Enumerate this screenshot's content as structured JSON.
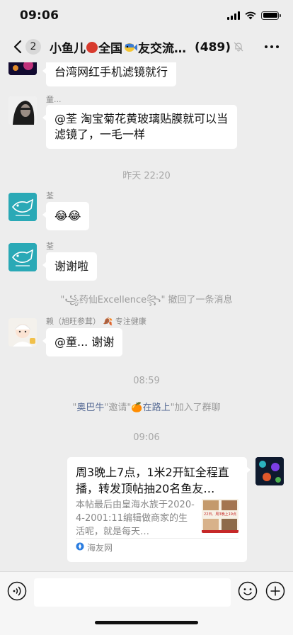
{
  "status_bar": {
    "time": "09:06"
  },
  "nav": {
    "unread_count": "2",
    "title_part1": "小鱼儿",
    "title_part2": "全国",
    "title_part3": "友交流…",
    "member_count": "(489)"
  },
  "messages": [
    {
      "id": "m1",
      "sender": "",
      "text": "台湾网红手机滤镜就行"
    },
    {
      "id": "m2",
      "sender": "童...",
      "text": "@荃 淘宝菊花黄玻璃贴膜就可以当滤镜了，一毛一样"
    },
    {
      "id": "m3",
      "sender": "荃",
      "text": "😂😂"
    },
    {
      "id": "m4",
      "sender": "荃",
      "text": "谢谢啦"
    },
    {
      "id": "m5",
      "sender": "赖（旭旺参茸）",
      "sender_emoji": "🍂",
      "sender_suffix": "专注健康",
      "text": "@童... 谢谢"
    }
  ],
  "timestamps": {
    "t1": "昨天 22:20",
    "t2": "08:59",
    "t3": "09:06"
  },
  "system": {
    "recall": "\"꧁药仙Excellence꧂\" 撤回了一条消息",
    "invite_q1": "\"",
    "invite_inviter": "奥巴牛",
    "invite_mid": "\"邀请\"",
    "invite_emoji": "🍊",
    "invite_invitee": "在路上",
    "invite_end": "\"加入了群聊"
  },
  "link_card": {
    "title": "周3晚上7点，1米2开缸全程直播，转发顶帖抽20名鱼友…",
    "description": "本帖最后由皇海水族于2020-4-2001:11编辑做商家的生活呢，就是每天…",
    "thumb_caption": "22日、周3晚上19点",
    "source": "海友网"
  },
  "colors": {
    "background": "#ededed",
    "bubble": "#ffffff",
    "link": "#576b95",
    "title_red": "#d83b2e"
  },
  "icons": [
    "back-icon",
    "mute-icon",
    "more-icon",
    "voice-icon",
    "emoji-icon",
    "plus-icon"
  ]
}
